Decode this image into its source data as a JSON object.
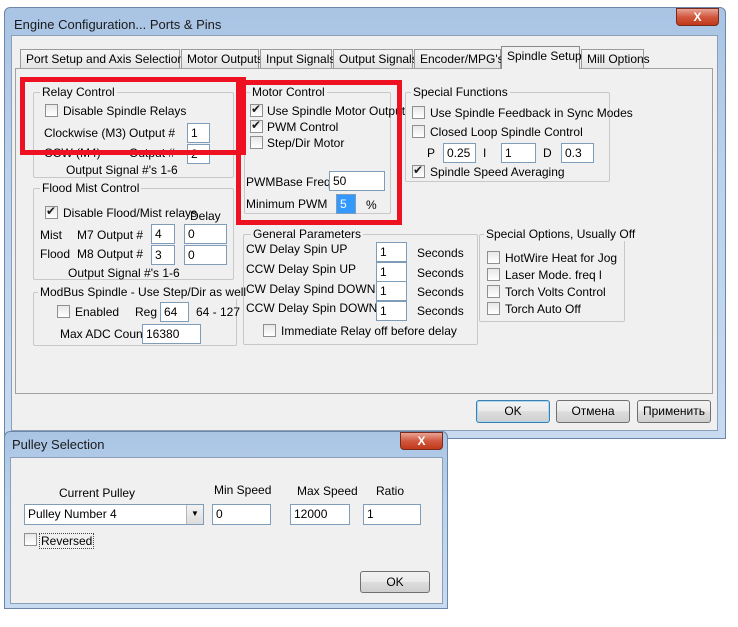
{
  "engine": {
    "title": "Engine Configuration... Ports & Pins",
    "close_glyph": "X",
    "tabs": [
      "Port Setup and Axis Selection",
      "Motor Outputs",
      "Input Signals",
      "Output Signals",
      "Encoder/MPG's",
      "Spindle Setup",
      "Mill Options"
    ],
    "active_tab": "Spindle Setup",
    "relay": {
      "legend": "Relay Control",
      "disable_label": "Disable Spindle Relays",
      "disable_checked": false,
      "cw_label": "Clockwise (M3)",
      "cw_output_label": "Output #",
      "cw_output_value": "1",
      "ccw_label": "CCW (M4)",
      "ccw_output_label": "Output #",
      "ccw_output_value": "2",
      "note": "Output Signal #'s 1-6"
    },
    "flood": {
      "legend": "Flood Mist Control",
      "disable_label": "Disable Flood/Mist relays",
      "disable_checked": true,
      "delay_header": "Delay",
      "mist_label": "Mist",
      "mist_output_label": "M7 Output #",
      "mist_output_value": "4",
      "mist_delay": "0",
      "flood_label": "Flood",
      "flood_output_label": "M8 Output #",
      "flood_output_value": "3",
      "flood_delay": "0",
      "note": "Output Signal #'s 1-6"
    },
    "modbus": {
      "legend": "ModBus Spindle - Use Step/Dir as well",
      "enabled_label": "Enabled",
      "enabled_checked": false,
      "reg_label": "Reg",
      "reg_value": "64",
      "reg_range": "64 - 127",
      "max_adc_label": "Max ADC Count",
      "max_adc_value": "16380"
    },
    "motor": {
      "legend": "Motor Control",
      "use_output_label": "Use Spindle Motor Output",
      "use_output_checked": true,
      "pwm_label": "PWM Control",
      "pwm_checked": true,
      "stepdir_label": "Step/Dir Motor",
      "stepdir_checked": false,
      "pwmbase_label": "PWMBase Freq.",
      "pwmbase_value": "50",
      "min_pwm_label": "Minimum PWM",
      "min_pwm_value": "5",
      "min_pwm_unit": "%"
    },
    "special": {
      "legend": "Special Functions",
      "feedback_label": "Use Spindle Feedback in Sync Modes",
      "feedback_checked": false,
      "closed_loop_label": "Closed Loop Spindle Control",
      "closed_loop_checked": false,
      "p_label": "P",
      "p_value": "0.25",
      "i_label": "I",
      "i_value": "1",
      "d_label": "D",
      "d_value": "0.3",
      "averaging_label": "Spindle Speed Averaging",
      "averaging_checked": true
    },
    "general": {
      "legend": "General Parameters",
      "rows": [
        {
          "label": "CW Delay Spin UP",
          "value": "1",
          "unit": "Seconds"
        },
        {
          "label": "CCW Delay Spin UP",
          "value": "1",
          "unit": "Seconds"
        },
        {
          "label": "CW Delay Spind DOWN",
          "value": "1",
          "unit": "Seconds"
        },
        {
          "label": "CCW Delay Spin DOWN",
          "value": "1",
          "unit": "Seconds"
        }
      ],
      "immediate_label": "Immediate Relay off before delay",
      "immediate_checked": false
    },
    "options": {
      "legend": "Special Options, Usually Off",
      "items": [
        {
          "label": "HotWire Heat for Jog",
          "checked": false
        },
        {
          "label": "Laser Mode. freq l",
          "checked": false
        },
        {
          "label": "Torch Volts Control",
          "checked": false
        },
        {
          "label": "Torch Auto Off",
          "checked": false
        }
      ]
    },
    "buttons": {
      "ok": "OK",
      "cancel": "Отмена",
      "apply": "Применить"
    }
  },
  "pulley": {
    "title": "Pulley Selection",
    "close_glyph": "X",
    "current_label": "Current Pulley",
    "current_value": "Pulley Number 4",
    "min_label": "Min Speed",
    "min_value": "0",
    "max_label": "Max Speed",
    "max_value": "12000",
    "ratio_label": "Ratio",
    "ratio_value": "1",
    "reversed_label": "Reversed",
    "reversed_checked": false,
    "ok": "OK"
  }
}
